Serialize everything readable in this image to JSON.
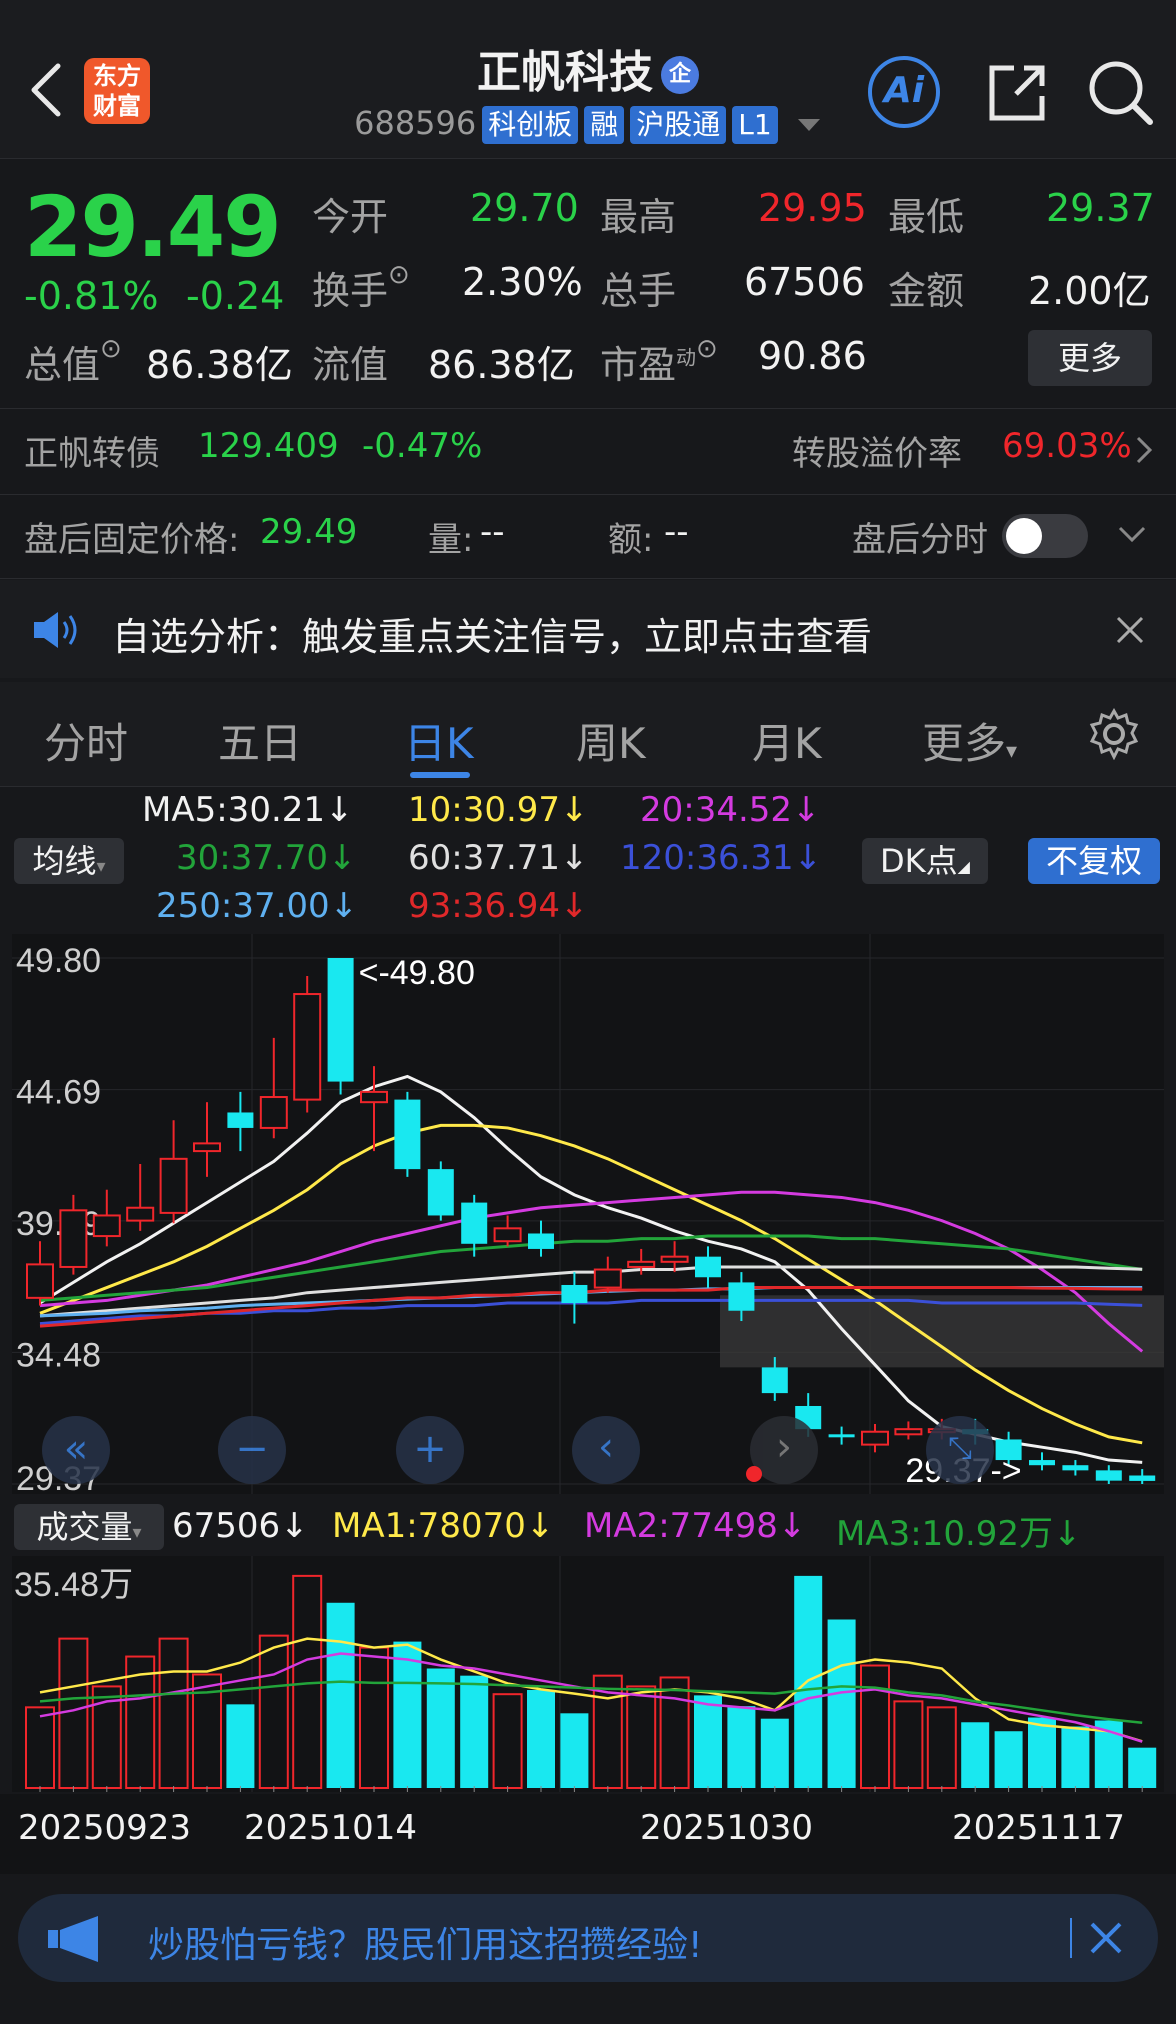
{
  "header": {
    "logo_text_1": "东方",
    "logo_text_2": "财富",
    "stock_name": "正帆科技",
    "name_badge": "企",
    "code": "688596",
    "tags": [
      "科创板",
      "融",
      "沪股通",
      "L1"
    ],
    "ai_label": "Ai"
  },
  "quote": {
    "price": "29.49",
    "change_pct": "-0.81%",
    "change": "-0.24",
    "open_label": "今开",
    "open": "29.70",
    "high_label": "最高",
    "high": "29.95",
    "low_label": "最低",
    "low": "29.37",
    "turnover_label": "换手",
    "turnover": "2.30%",
    "volume_label": "总手",
    "volume": "67506",
    "amount_label": "金额",
    "amount": "2.00亿",
    "mktcap_label": "总值",
    "mktcap": "86.38亿",
    "float_label": "流值",
    "float_cap": "86.38亿",
    "pe_label": "市盈",
    "pe_sup": "动",
    "pe": "90.86",
    "more_button": "更多"
  },
  "bond": {
    "name": "正帆转债",
    "price": "129.409",
    "change": "-0.47%",
    "premium_label": "转股溢价率",
    "premium": "69.03%"
  },
  "after_hours": {
    "fixed_label": "盘后固定价格:",
    "fixed_price": "29.49",
    "qty_label": "量:",
    "qty": "--",
    "amount_label": "额:",
    "amount": "--",
    "toggle_label": "盘后分时"
  },
  "notice": {
    "text": "自选分析：触发重点关注信号，立即点击查看"
  },
  "tabs": [
    "分时",
    "五日",
    "日K",
    "周K",
    "月K",
    "更多"
  ],
  "active_tab": "日K",
  "ma_panel": {
    "selector": "均线",
    "dk_button": "DK点",
    "adjust_button": "不复权",
    "items": [
      {
        "text": "MA5:30.21↓",
        "color": "#f2f2f2"
      },
      {
        "text": "10:30.97↓",
        "color": "#ffe94a"
      },
      {
        "text": "20:34.52↓",
        "color": "#d43be0"
      },
      {
        "text": "30:37.70↓",
        "color": "#22a43a"
      },
      {
        "text": "60:37.71↓",
        "color": "#e0e0e0"
      },
      {
        "text": "120:36.31↓",
        "color": "#3b50d8"
      },
      {
        "text": "250:37.00↓",
        "color": "#5fb0f0"
      },
      {
        "text": "93:36.94↓",
        "color": "#e0282a"
      }
    ]
  },
  "chart_data": {
    "type": "candlestick",
    "y_ticks": [
      "49.80",
      "44.69",
      "39.59",
      "34.48",
      "29.37"
    ],
    "ylim": [
      29.37,
      49.8
    ],
    "max_label": "<-49.80",
    "min_label": "29.37->",
    "candles": [
      {
        "o": 36.6,
        "c": 37.9,
        "h": 38.8,
        "l": 36.3
      },
      {
        "o": 37.8,
        "c": 40.0,
        "h": 40.6,
        "l": 37.5
      },
      {
        "o": 39.0,
        "c": 39.8,
        "h": 40.8,
        "l": 38.6
      },
      {
        "o": 39.6,
        "c": 40.1,
        "h": 41.8,
        "l": 39.2
      },
      {
        "o": 39.9,
        "c": 42.0,
        "h": 43.5,
        "l": 39.5
      },
      {
        "o": 42.3,
        "c": 42.6,
        "h": 44.2,
        "l": 41.3
      },
      {
        "o": 43.8,
        "c": 43.2,
        "h": 44.6,
        "l": 42.3
      },
      {
        "o": 43.2,
        "c": 44.4,
        "h": 46.7,
        "l": 42.8
      },
      {
        "o": 44.3,
        "c": 48.4,
        "h": 49.1,
        "l": 43.8
      },
      {
        "o": 49.8,
        "c": 45.0,
        "h": 49.8,
        "l": 44.5
      },
      {
        "o": 44.2,
        "c": 44.6,
        "h": 45.6,
        "l": 42.3
      },
      {
        "o": 44.3,
        "c": 41.6,
        "h": 44.6,
        "l": 41.3
      },
      {
        "o": 41.6,
        "c": 39.8,
        "h": 41.9,
        "l": 39.6
      },
      {
        "o": 40.3,
        "c": 38.7,
        "h": 40.6,
        "l": 38.2
      },
      {
        "o": 38.8,
        "c": 39.3,
        "h": 39.8,
        "l": 38.6
      },
      {
        "o": 39.1,
        "c": 38.5,
        "h": 39.6,
        "l": 38.2
      },
      {
        "o": 37.1,
        "c": 36.4,
        "h": 37.6,
        "l": 35.6
      },
      {
        "o": 37.0,
        "c": 37.7,
        "h": 38.2,
        "l": 36.8
      },
      {
        "o": 37.8,
        "c": 38.0,
        "h": 38.5,
        "l": 37.5
      },
      {
        "o": 38.0,
        "c": 38.2,
        "h": 38.8,
        "l": 37.6
      },
      {
        "o": 38.2,
        "c": 37.4,
        "h": 38.6,
        "l": 37.0
      },
      {
        "o": 37.2,
        "c": 36.1,
        "h": 37.6,
        "l": 35.7
      },
      {
        "o": 33.9,
        "c": 32.9,
        "h": 34.3,
        "l": 32.6
      },
      {
        "o": 32.4,
        "c": 31.5,
        "h": 32.9,
        "l": 31.2
      },
      {
        "o": 31.3,
        "c": 31.2,
        "h": 31.6,
        "l": 30.9
      },
      {
        "o": 30.9,
        "c": 31.4,
        "h": 31.7,
        "l": 30.6
      },
      {
        "o": 31.3,
        "c": 31.5,
        "h": 31.8,
        "l": 31.1
      },
      {
        "o": 31.4,
        "c": 31.5,
        "h": 31.9,
        "l": 31.1
      },
      {
        "o": 31.5,
        "c": 31.3,
        "h": 31.9,
        "l": 30.9
      },
      {
        "o": 31.1,
        "c": 30.3,
        "h": 31.4,
        "l": 30.1
      },
      {
        "o": 30.3,
        "c": 30.1,
        "h": 30.6,
        "l": 29.9
      },
      {
        "o": 30.1,
        "c": 29.9,
        "h": 30.3,
        "l": 29.7
      },
      {
        "o": 29.9,
        "c": 29.5,
        "h": 30.1,
        "l": 29.37
      },
      {
        "o": 29.7,
        "c": 29.49,
        "h": 29.95,
        "l": 29.37
      }
    ],
    "ma_lines": [
      {
        "name": "MA5",
        "color": "#f2f2f2",
        "values": [
          36.4,
          37.2,
          38.0,
          38.7,
          39.5,
          40.3,
          41.1,
          41.9,
          43.0,
          44.2,
          44.8,
          45.2,
          44.6,
          43.6,
          42.4,
          41.3,
          40.6,
          40.1,
          39.7,
          39.2,
          38.8,
          38.5,
          38.0,
          36.9,
          35.4,
          34.0,
          32.6,
          31.6,
          31.3,
          31.0,
          30.8,
          30.6,
          30.3,
          30.21
        ]
      },
      {
        "name": "MA10",
        "color": "#ffe94a",
        "values": [
          36.0,
          36.5,
          37.0,
          37.5,
          38.0,
          38.6,
          39.3,
          40.0,
          40.8,
          41.8,
          42.5,
          43.0,
          43.3,
          43.3,
          43.2,
          42.9,
          42.5,
          42.0,
          41.4,
          40.8,
          40.2,
          39.6,
          38.9,
          38.1,
          37.3,
          36.5,
          35.6,
          34.7,
          33.8,
          33.0,
          32.3,
          31.7,
          31.2,
          30.97
        ]
      },
      {
        "name": "MA20",
        "color": "#d43be0",
        "values": [
          36.3,
          36.4,
          36.5,
          36.7,
          36.9,
          37.1,
          37.4,
          37.7,
          38.0,
          38.4,
          38.8,
          39.1,
          39.4,
          39.7,
          39.9,
          40.1,
          40.2,
          40.3,
          40.4,
          40.5,
          40.6,
          40.7,
          40.7,
          40.6,
          40.5,
          40.3,
          40.0,
          39.6,
          39.1,
          38.5,
          37.7,
          36.8,
          35.6,
          34.52
        ]
      },
      {
        "name": "MA30",
        "color": "#22a43a",
        "values": [
          36.5,
          36.6,
          36.7,
          36.8,
          36.9,
          37.0,
          37.2,
          37.4,
          37.6,
          37.8,
          38.0,
          38.2,
          38.4,
          38.5,
          38.6,
          38.7,
          38.8,
          38.8,
          38.9,
          38.9,
          39.0,
          39.0,
          39.0,
          39.0,
          38.9,
          38.9,
          38.8,
          38.7,
          38.6,
          38.5,
          38.3,
          38.1,
          37.9,
          37.7
        ]
      },
      {
        "name": "MA60",
        "color": "#e0e0e0",
        "values": [
          35.9,
          36.0,
          36.1,
          36.2,
          36.3,
          36.4,
          36.5,
          36.6,
          36.8,
          36.9,
          37.0,
          37.1,
          37.2,
          37.3,
          37.4,
          37.5,
          37.6,
          37.6,
          37.7,
          37.7,
          37.8,
          37.8,
          37.8,
          37.8,
          37.8,
          37.8,
          37.8,
          37.8,
          37.8,
          37.8,
          37.8,
          37.8,
          37.75,
          37.71
        ]
      },
      {
        "name": "MA120",
        "color": "#3b50d8",
        "values": [
          35.6,
          35.7,
          35.8,
          35.9,
          35.9,
          36.0,
          36.0,
          36.1,
          36.1,
          36.2,
          36.2,
          36.3,
          36.3,
          36.3,
          36.4,
          36.4,
          36.4,
          36.4,
          36.5,
          36.5,
          36.5,
          36.5,
          36.5,
          36.5,
          36.5,
          36.5,
          36.5,
          36.4,
          36.4,
          36.4,
          36.4,
          36.4,
          36.35,
          36.31
        ]
      },
      {
        "name": "MA250",
        "color": "#5fb0f0",
        "values": [
          35.9,
          35.95,
          36.0,
          36.1,
          36.15,
          36.2,
          36.3,
          36.35,
          36.4,
          36.45,
          36.5,
          36.55,
          36.6,
          36.65,
          36.7,
          36.75,
          36.8,
          36.85,
          36.9,
          36.9,
          36.95,
          36.95,
          37.0,
          37.0,
          37.0,
          37.0,
          37.0,
          37.0,
          37.0,
          37.0,
          37.0,
          37.0,
          37.0,
          37.0
        ]
      },
      {
        "name": "MA93",
        "color": "#e0282a",
        "values": [
          35.5,
          35.6,
          35.7,
          35.8,
          35.9,
          36.0,
          36.1,
          36.2,
          36.3,
          36.4,
          36.5,
          36.6,
          36.6,
          36.7,
          36.7,
          36.8,
          36.8,
          36.9,
          36.9,
          36.9,
          36.9,
          37.0,
          37.0,
          37.0,
          37.0,
          37.0,
          37.0,
          37.0,
          37.0,
          37.0,
          36.98,
          36.97,
          36.95,
          36.94
        ]
      }
    ],
    "x_ticks": [
      "20250923",
      "20251014",
      "20251030",
      "20251117"
    ],
    "volume": {
      "selector": "成交量",
      "current": "67506↓",
      "ma1": "MA1:78070↓",
      "ma2": "MA2:77498↓",
      "ma3": "MA3:10.92万↓",
      "max_label": "35.48万",
      "max": 354800,
      "values": [
        135000,
        250000,
        170000,
        220000,
        250000,
        190000,
        140000,
        255000,
        355000,
        310000,
        235000,
        245000,
        200000,
        188000,
        157000,
        164000,
        125000,
        188000,
        170000,
        185000,
        155000,
        137000,
        116000,
        355000,
        282000,
        205000,
        145000,
        135000,
        110000,
        95000,
        118000,
        103000,
        113000,
        67506
      ],
      "ma1_values": [
        160000,
        170000,
        180000,
        190000,
        195000,
        195000,
        210000,
        235000,
        250000,
        245000,
        235000,
        240000,
        215000,
        195000,
        175000,
        165000,
        158000,
        150000,
        160000,
        165000,
        160000,
        150000,
        130000,
        180000,
        205000,
        215000,
        210000,
        200000,
        150000,
        115000,
        105000,
        100000,
        95000,
        78070
      ],
      "ma2_values": [
        120000,
        130000,
        145000,
        150000,
        160000,
        170000,
        180000,
        190000,
        215000,
        225000,
        220000,
        215000,
        205000,
        200000,
        190000,
        180000,
        170000,
        160000,
        155000,
        150000,
        140000,
        135000,
        130000,
        150000,
        160000,
        165000,
        155000,
        150000,
        140000,
        130000,
        120000,
        110000,
        95000,
        77498
      ],
      "ma3_values": [
        145000,
        150000,
        152000,
        155000,
        158000,
        160000,
        165000,
        170000,
        175000,
        178000,
        176000,
        176000,
        175000,
        174000,
        172000,
        170000,
        168000,
        166000,
        165000,
        164000,
        162000,
        160000,
        158000,
        165000,
        170000,
        168000,
        160000,
        155000,
        145000,
        138000,
        130000,
        122000,
        115000,
        109200
      ]
    }
  },
  "ad_banner": {
    "text": "炒股怕亏钱？股民们用这招攒经验!"
  },
  "colors": {
    "up": "#f0262b",
    "down": "#2ad24a",
    "candle_down": "#19e8f0",
    "accent": "#3d85e6"
  }
}
